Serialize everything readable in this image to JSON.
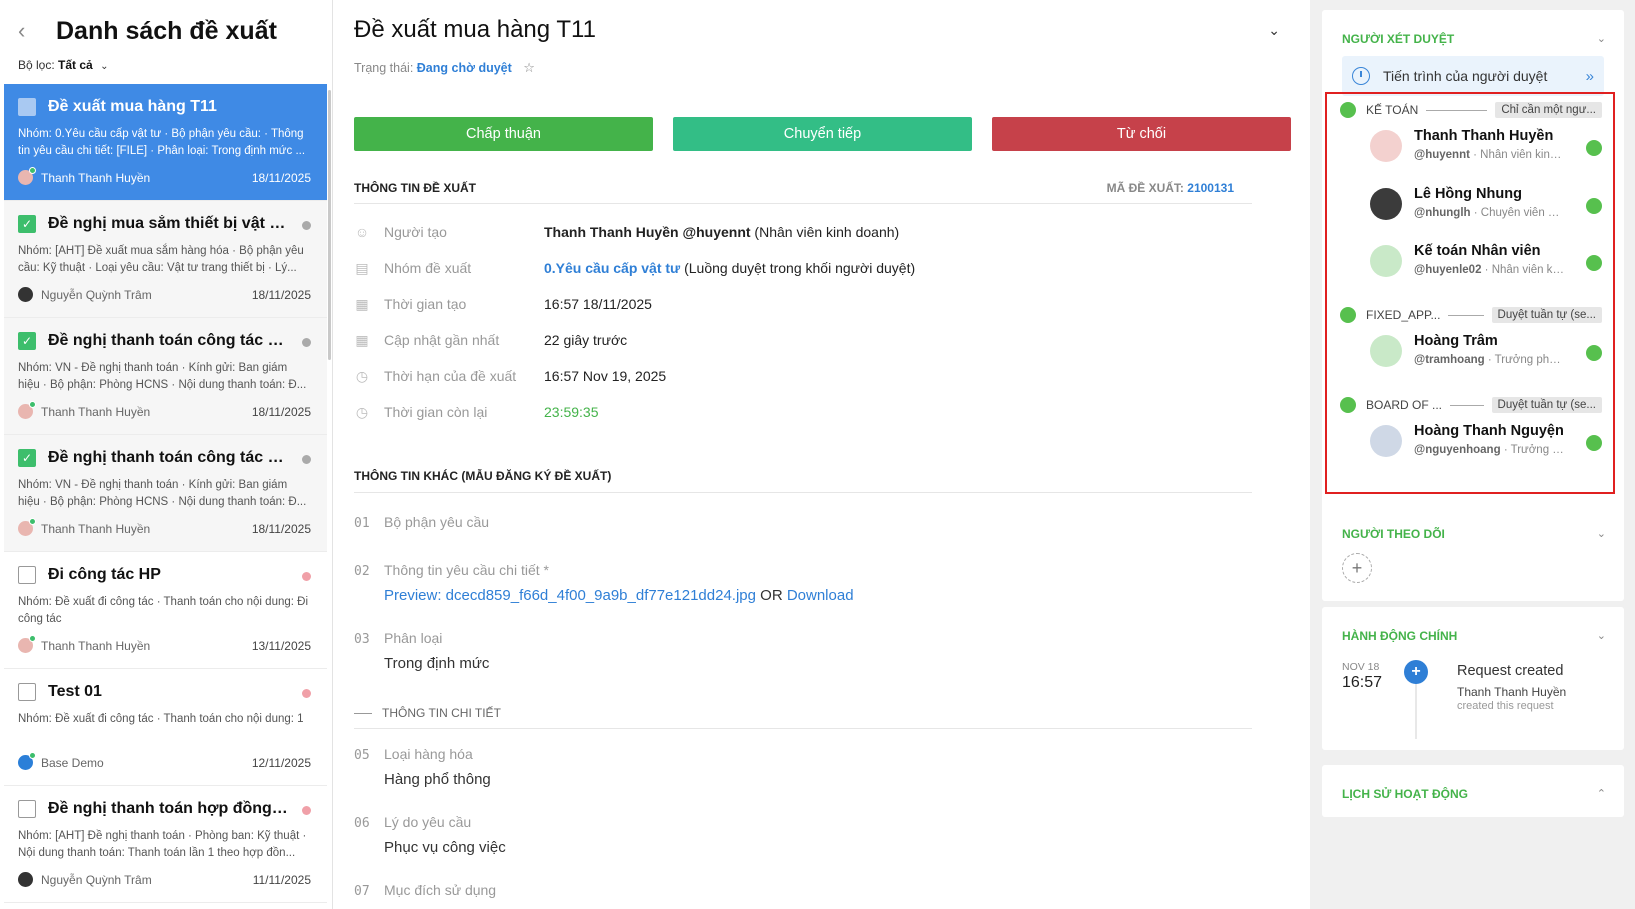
{
  "left": {
    "back_icon": "chevron-left-icon",
    "title": "Danh sách đề xuất",
    "filter_label": "Bộ lọc:",
    "filter_value": "Tất cả",
    "items": [
      {
        "title": "Đề xuất mua hàng T11",
        "desc": "Nhóm: 0.Yêu cầu cấp vật tư · Bộ phận yêu cầu: · Thông tin yêu cầu chi tiết: [FILE] · Phân loại: Trong định mức ...",
        "author": "Thanh Thanh Huyền",
        "date": "18/11/2025"
      },
      {
        "title": "Đề nghị mua sắm thiết bị vật tư...",
        "desc": "Nhóm: [AHT] Đề xuất mua sắm hàng hóa · Bộ phận yêu cầu: Kỹ thuật · Loại yêu cầu: Vật tư trang thiết bị · Lý...",
        "author": "Nguyễn Quỳnh Trâm",
        "date": "18/11/2025"
      },
      {
        "title": "Đề nghị thanh toán công tác phí...",
        "desc": "Nhóm: VN - Đề nghị thanh toán · Kính gửi: Ban giám hiệu · Bộ phận: Phòng HCNS · Nội dung thanh toán: Đ...",
        "author": "Thanh Thanh Huyền",
        "date": "18/11/2025"
      },
      {
        "title": "Đề nghị thanh toán công tác phí...",
        "desc": "Nhóm: VN - Đề nghị thanh toán · Kính gửi: Ban giám hiệu · Bộ phận: Phòng HCNS · Nội dung thanh toán: Đ...",
        "author": "Thanh Thanh Huyền",
        "date": "18/11/2025"
      },
      {
        "title": "Đi công tác HP",
        "desc": "Nhóm: Đề xuất đi công tác · Thanh toán cho nội dung: Đi công tác",
        "author": "Thanh Thanh Huyền",
        "date": "13/11/2025"
      },
      {
        "title": "Test 01",
        "desc": "Nhóm: Đề xuất đi công tác · Thanh toán cho nội dung: 1",
        "author": "Base Demo",
        "date": "12/11/2025"
      },
      {
        "title": "Đề nghị thanh toán hợp đồng m...",
        "desc": "Nhóm: [AHT] Đề nghị thanh toán · Phòng ban: Kỹ thuật · Nội dung thanh toán: Thanh toán lần 1 theo hợp đồn...",
        "author": "Nguyễn Quỳnh Trâm",
        "date": "11/11/2025"
      }
    ]
  },
  "main": {
    "title": "Đề xuất mua hàng T11",
    "status_label": "Trạng thái:",
    "status_value": "Đang chờ duyệt",
    "buttons": {
      "approve": "Chấp thuận",
      "forward": "Chuyển tiếp",
      "reject": "Từ chối"
    },
    "info_heading": "THÔNG TIN ĐỀ XUẤT",
    "code_label": "MÃ ĐỀ XUẤT:",
    "code_value": "2100131",
    "fields": [
      {
        "label": "Người tạo",
        "value": "Thanh Thanh Huyền @huyennt",
        "extra": " (Nhân viên kinh doanh)"
      },
      {
        "label": "Nhóm đề xuất",
        "value": "0.Yêu cầu cấp vật tư",
        "extra": " (Luồng duyệt trong khối người duyệt)"
      },
      {
        "label": "Thời gian tạo",
        "value": "16:57 18/11/2025"
      },
      {
        "label": "Cập nhật gần nhất",
        "value": "22 giây trước"
      },
      {
        "label": "Thời hạn của đề xuất",
        "value": "16:57 Nov 19, 2025"
      },
      {
        "label": "Thời gian còn lại",
        "value": "23:59:35"
      }
    ],
    "other_heading": "THÔNG TIN KHÁC (MẪU ĐĂNG KÝ ĐỀ XUẤT)",
    "other_fields": [
      {
        "num": "01",
        "label": "Bộ phận yêu cầu"
      },
      {
        "num": "02",
        "label": "Thông tin yêu cầu chi tiết *",
        "preview": "Preview: dcecd859_f66d_4f00_9a9b_df77e121dd24.jpg",
        "or": "OR",
        "download": "Download"
      },
      {
        "num": "03",
        "label": "Phân loại",
        "value": "Trong định mức"
      },
      {
        "num": "05",
        "label": "Loại hàng hóa",
        "value": "Hàng phổ thông"
      },
      {
        "num": "06",
        "label": "Lý do yêu cầu",
        "value": "Phục vụ công việc"
      },
      {
        "num": "07",
        "label": "Mục đích sử dụng"
      }
    ],
    "detail_heading": "THÔNG TIN CHI TIẾT"
  },
  "right": {
    "approvers_heading": "NGƯỜI XÉT DUYỆT",
    "progress_label": "Tiến trình của người duyệt",
    "groups": [
      {
        "name": "KẾ TOÁN",
        "tag": "Chỉ cần một ngư..."
      },
      {
        "name": "FIXED_APP...",
        "tag": "Duyệt tuần tự (se..."
      },
      {
        "name": "BOARD OF ...",
        "tag": "Duyệt tuần tự (se..."
      }
    ],
    "people": [
      {
        "name": "Thanh Thanh Huyền",
        "handle": "@huyennt",
        "role": "· Nhân viên kinh ..."
      },
      {
        "name": "Lê Hồng Nhung",
        "handle": "@nhunglh",
        "role": "· Chuyên viên kế ..."
      },
      {
        "name": "Kế toán Nhân viên",
        "handle": "@huyenle02",
        "role": "· Nhân viên ki..."
      },
      {
        "name": "Hoàng Trâm",
        "handle": "@tramhoang",
        "role": "· Trưởng phòn..."
      },
      {
        "name": "Hoàng Thanh Nguyện",
        "handle": "@nguyenhoang",
        "role": "· Trưởng p..."
      }
    ],
    "followers_heading": "NGƯỜI THEO DÕI",
    "actions_heading": "HÀNH ĐỘNG CHÍNH",
    "action": {
      "month": "NOV 18",
      "time": "16:57",
      "title": "Request created",
      "actor": "Thanh Thanh Huyền",
      "desc": "created this request"
    },
    "history_heading": "LỊCH SỬ HOẠT ĐỘNG"
  },
  "colors": {
    "accent_blue": "#3f8ae5",
    "approve": "#44b34a",
    "forward": "#33be86",
    "reject": "#c6414a",
    "section_green": "#44b34a",
    "highlight_red": "#e02020"
  }
}
